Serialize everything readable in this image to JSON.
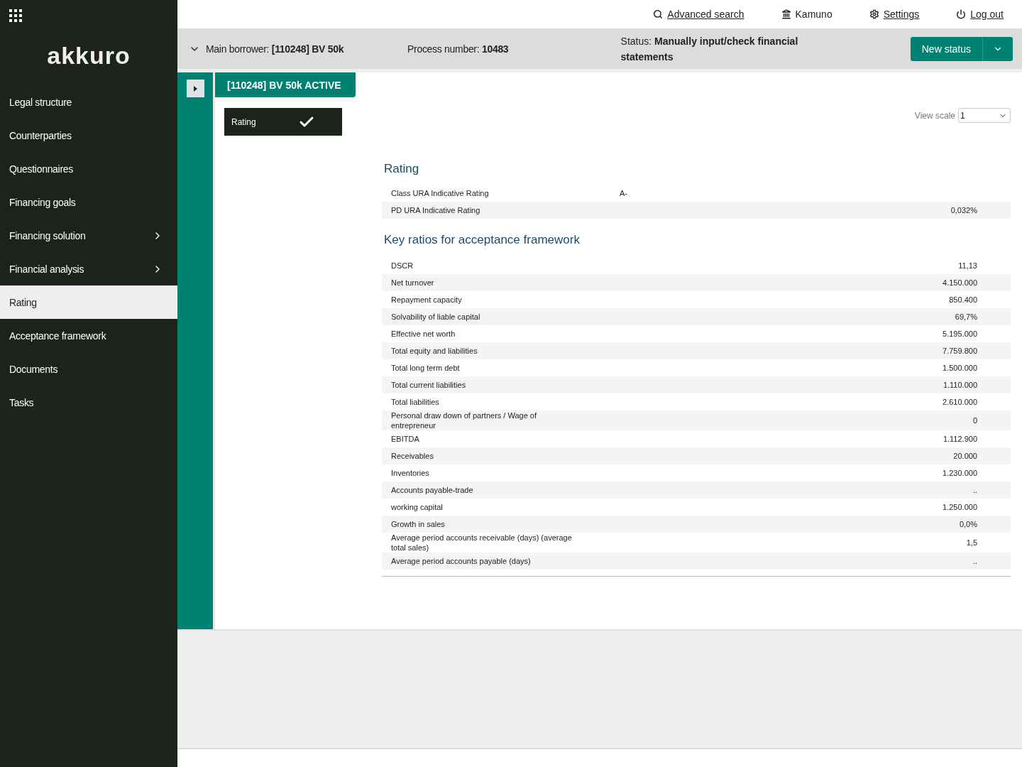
{
  "sidebar": {
    "logo": "akkuro",
    "items": [
      {
        "label": "Legal structure",
        "selected": false,
        "expandable": false
      },
      {
        "label": "Counterparties",
        "selected": false,
        "expandable": false
      },
      {
        "label": "Questionnaires",
        "selected": false,
        "expandable": false
      },
      {
        "label": "Financing goals",
        "selected": false,
        "expandable": false
      },
      {
        "label": "Financing solution",
        "selected": false,
        "expandable": true
      },
      {
        "label": "Financial analysis",
        "selected": false,
        "expandable": true
      },
      {
        "label": "Rating",
        "selected": true,
        "expandable": false
      },
      {
        "label": "Acceptance framework",
        "selected": false,
        "expandable": false
      },
      {
        "label": "Documents",
        "selected": false,
        "expandable": false
      },
      {
        "label": "Tasks",
        "selected": false,
        "expandable": false
      }
    ]
  },
  "top_links": [
    {
      "kind": "search",
      "label": "Advanced search",
      "link": true
    },
    {
      "kind": "bank",
      "label": "Kamuno",
      "link": false
    },
    {
      "kind": "settings",
      "label": "Settings",
      "link": true
    },
    {
      "kind": "power",
      "label": "Log out",
      "link": true
    }
  ],
  "header": {
    "borrower_label": "Main borrower:",
    "borrower": "[110248] BV 50k",
    "process_label": "Process number:",
    "process": "10483",
    "status_label": "Status:",
    "status": "Manually input/check financial statements",
    "button": "New status"
  },
  "entity_tab": "[110248] BV 50k ACTIVE",
  "rating_tab": {
    "label": "Rating",
    "selected": true
  },
  "view_scale": {
    "label": "View scale",
    "value": "1"
  },
  "rating": {
    "title": "Rating",
    "rows": [
      {
        "label": "Class URA Indicative Rating",
        "kind": "middle",
        "value": "A-"
      },
      {
        "label": "PD URA Indicative Rating",
        "kind": "right",
        "value": "0,032%"
      }
    ]
  },
  "key_ratios": {
    "title": "Key ratios for acceptance framework",
    "rows": [
      {
        "label": "DSCR",
        "value": "11,13"
      },
      {
        "label": "Net turnover",
        "value": "4.150.000"
      },
      {
        "label": "Repayment capacity",
        "value": "850.400"
      },
      {
        "label": "Solvability of liable capital",
        "value": "69,7%"
      },
      {
        "label": "Effective net worth",
        "value": "5.195.000"
      },
      {
        "label": "Total equity and liabilities",
        "value": "7.759.800"
      },
      {
        "label": "Total long term debt",
        "value": "1.500.000"
      },
      {
        "label": "Total current liabilities",
        "value": "1.110.000"
      },
      {
        "label": "Total liabilities",
        "value": "2.610.000"
      },
      {
        "label": "Personal draw down of partners / Wage of entrepreneur",
        "value": "0"
      },
      {
        "label": "EBITDA",
        "value": "1.112.900"
      },
      {
        "label": "Receivables",
        "value": "20.000"
      },
      {
        "label": "Inventories",
        "value": "1.230.000"
      },
      {
        "label": "Accounts payable-trade",
        "value": ".."
      },
      {
        "label": "working capital",
        "value": "1.250.000"
      },
      {
        "label": "Growth in sales",
        "value": "0,0%"
      },
      {
        "label": "Average period accounts receivable (days) (average total sales)",
        "value": "1,5"
      },
      {
        "label": "Average period accounts payable (days)",
        "value": ".."
      }
    ]
  }
}
